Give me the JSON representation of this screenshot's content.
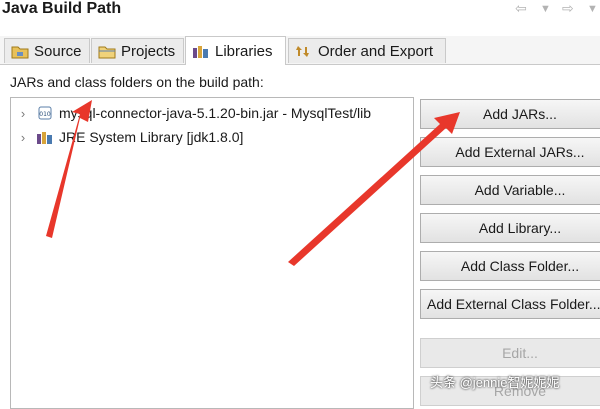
{
  "window": {
    "title": "Java Build Path",
    "back_icon": "back-arrow-icon",
    "forward_icon": "forward-arrow-icon"
  },
  "tabs": [
    {
      "label": "Source",
      "icon": "source-folder-icon",
      "active": false
    },
    {
      "label": "Projects",
      "icon": "projects-icon",
      "active": false
    },
    {
      "label": "Libraries",
      "icon": "libraries-icon",
      "active": true
    },
    {
      "label": "Order and Export",
      "icon": "order-export-icon",
      "active": false
    }
  ],
  "build_path_label": "JARs and class folders on the build path:",
  "tree": {
    "items": [
      {
        "label": "mysql-connector-java-5.1.20-bin.jar - MysqlTest/lib",
        "icon": "jar-icon"
      },
      {
        "label": "JRE System Library [jdk1.8.0]",
        "icon": "library-icon"
      }
    ]
  },
  "buttons": {
    "add_jars": "Add JARs...",
    "add_external_jars": "Add External JARs...",
    "add_variable": "Add Variable...",
    "add_library": "Add Library...",
    "add_class_folder": "Add Class Folder...",
    "add_external_class_folder": "Add External Class Folder...",
    "edit": "Edit...",
    "remove": "Remove"
  },
  "watermark": "头条 @jennie智妮妮妮",
  "colors": {
    "arrow": "#e8372b"
  }
}
